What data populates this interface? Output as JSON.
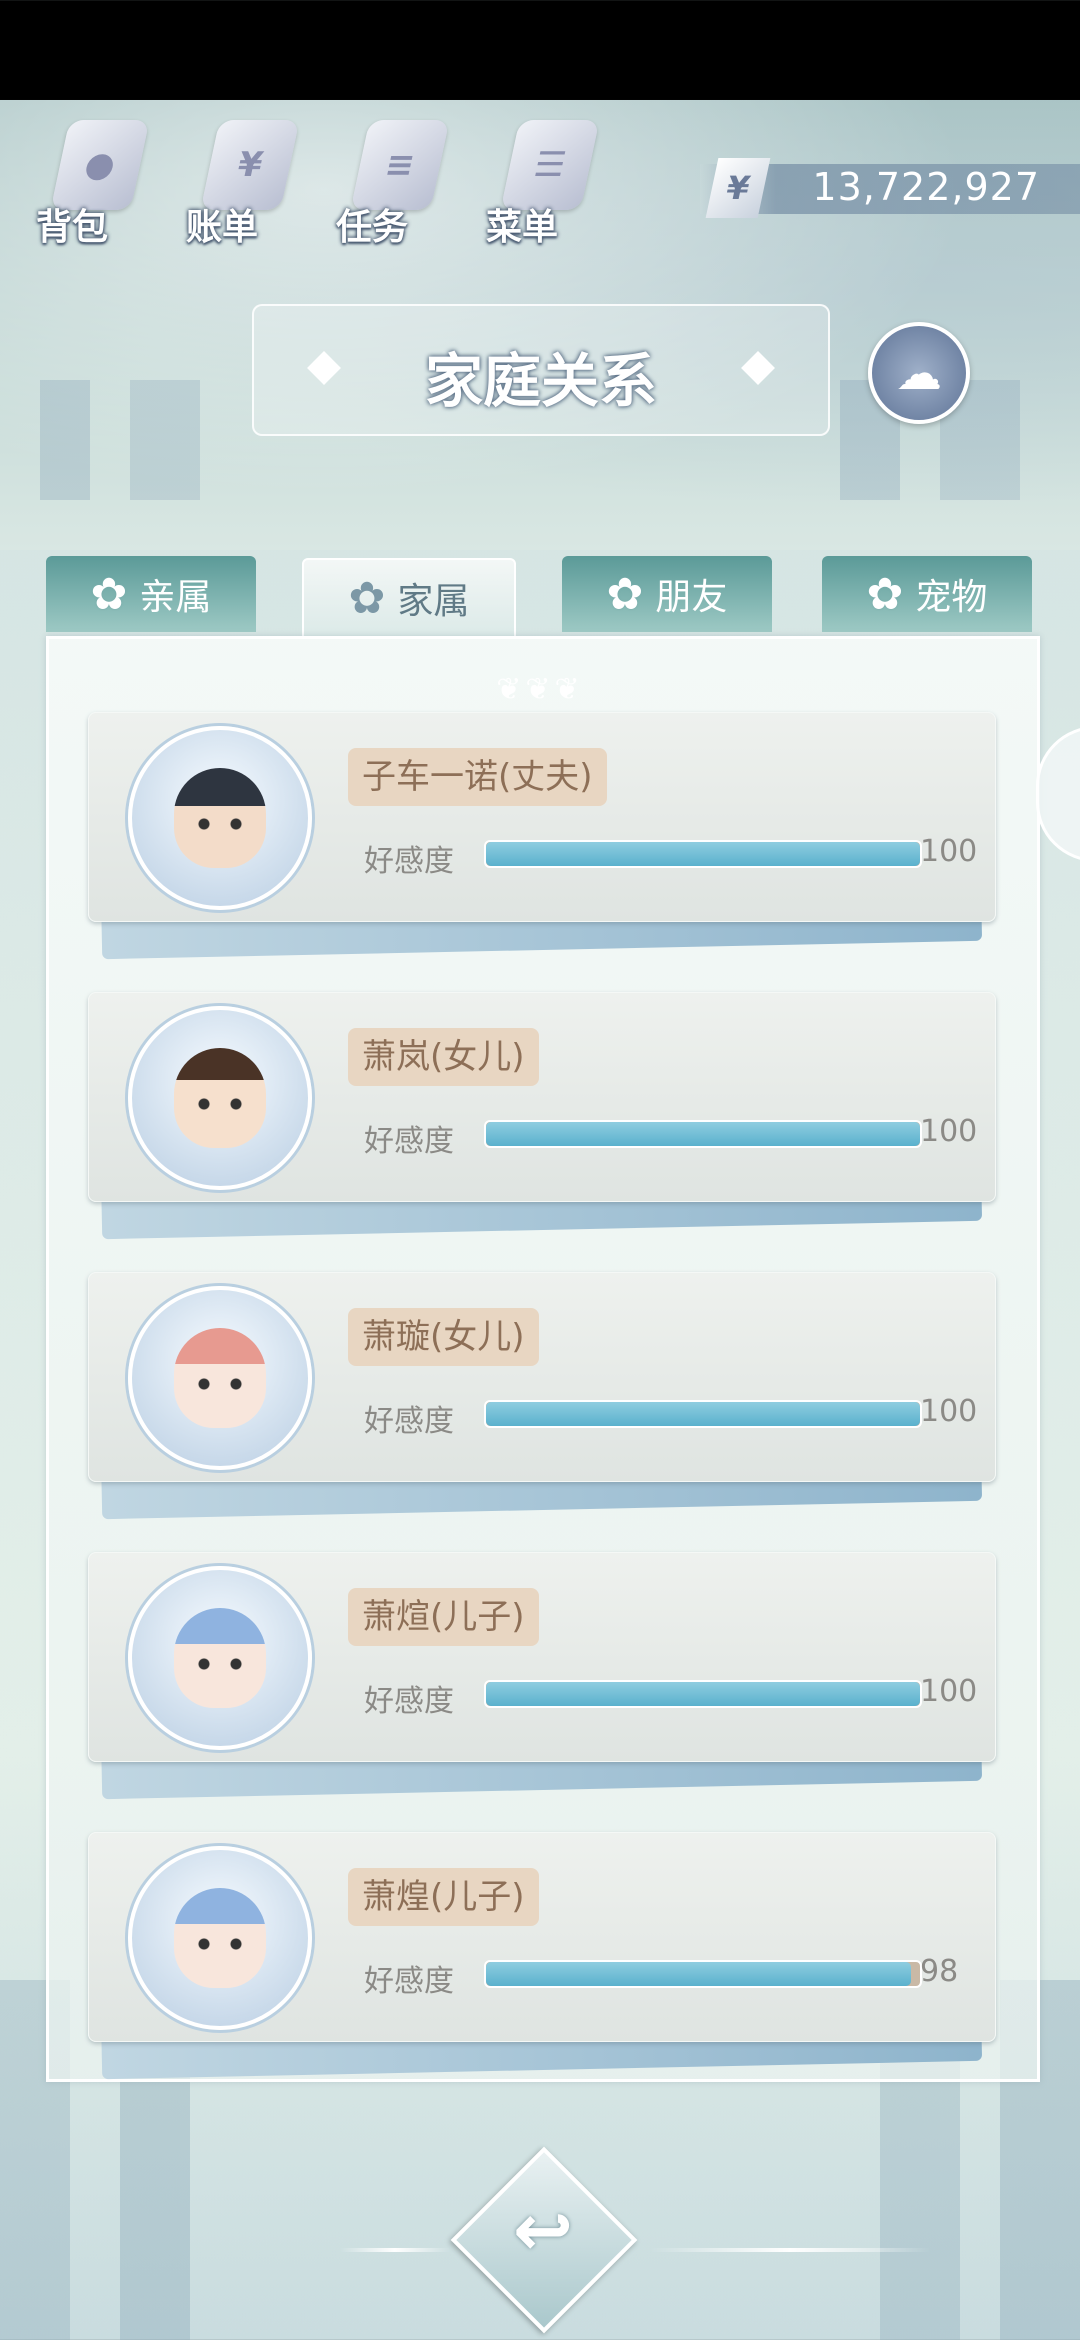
{
  "toolbar": {
    "bag": "背包",
    "bill": "账单",
    "task": "任务",
    "menu": "菜单"
  },
  "currency": {
    "symbol": "¥",
    "amount": "13,722,927"
  },
  "title": "家庭关系",
  "tabs": [
    {
      "label": "亲属",
      "active": false
    },
    {
      "label": "家属",
      "active": true
    },
    {
      "label": "朋友",
      "active": false
    },
    {
      "label": "宠物",
      "active": false
    }
  ],
  "affection_label": "好感度",
  "members": [
    {
      "name": "子车一诺(丈夫)",
      "affection": 100,
      "max": 100
    },
    {
      "name": "萧岚(女儿)",
      "affection": 100,
      "max": 100
    },
    {
      "name": "萧璇(女儿)",
      "affection": 100,
      "max": 100
    },
    {
      "name": "萧煊(儿子)",
      "affection": 100,
      "max": 100
    },
    {
      "name": "萧煌(儿子)",
      "affection": 98,
      "max": 100
    }
  ],
  "colors": {
    "bar_fill": "#5ab1cd",
    "tab_bg": "#5b9a98",
    "name_tag": "#e8d6c2"
  }
}
